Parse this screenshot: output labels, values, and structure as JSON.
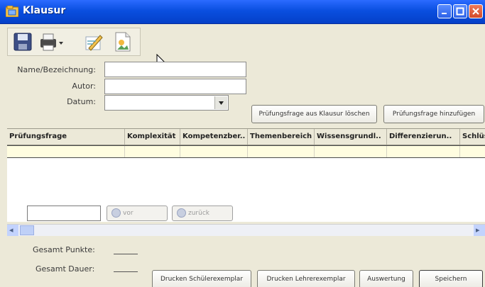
{
  "window": {
    "title": "Klausur",
    "accent": "#0a4fe0"
  },
  "toolbar": {
    "tools": [
      "save-icon",
      "print-icon",
      "edit-icon",
      "image-document-icon"
    ]
  },
  "form": {
    "name_label": "Name/Bezeichnung:",
    "name_value": "",
    "author_label": "Autor:",
    "author_value": "",
    "date_label": "Datum:",
    "date_value": ""
  },
  "actions": {
    "delete_question": "Prüfungsfrage aus Klausur löschen",
    "add_question": "Prüfungsfrage hinzufügen"
  },
  "table": {
    "columns": [
      "Prüfungsfrage",
      "Komplexität",
      "Kompetenzber..",
      "Themenbereich",
      "Wissensgrundl..",
      "Differenzierun..",
      "Schlüs"
    ]
  },
  "navigation": {
    "input_value": "",
    "forward_label": "vor",
    "back_label": "zurück"
  },
  "summary": {
    "points_label": "Gesamt Punkte:",
    "duration_label": "Gesamt Dauer:"
  },
  "footer": {
    "print_student": "Drucken Schülerexemplar",
    "print_teacher": "Drucken Lehrerexemplar",
    "evaluation": "Auswertung",
    "save": "Speichern"
  }
}
